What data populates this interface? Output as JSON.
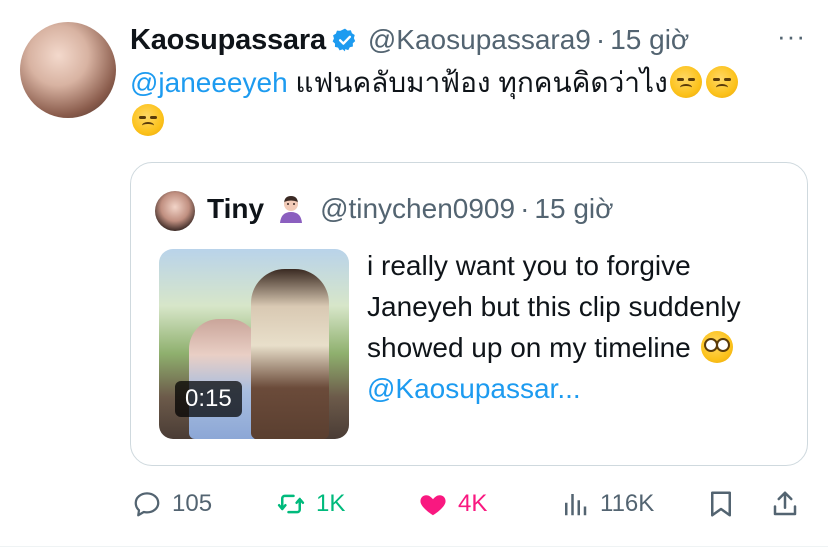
{
  "tweet": {
    "author_name": "Kaosupassara",
    "author_handle": "@Kaosupassara9",
    "separator": "·",
    "time": "15 giờ",
    "more_label": "···",
    "mention": "@janeeeyeh",
    "text": " แฟนคลับมาฟ้อง ทุกคนคิดว่าไง"
  },
  "quoted": {
    "author_name": "Tiny",
    "author_handle": "@tinychen0909",
    "separator": "·",
    "time": "15 giờ",
    "video_duration": "0:15",
    "text": "i really want you to forgive Janeyeh but this clip suddenly showed up on my timeline",
    "mention": "@Kaosupassar..."
  },
  "actions": {
    "replies": "105",
    "retweets": "1K",
    "likes": "4K",
    "views": "116K"
  },
  "colors": {
    "accent": "#1d9bf0",
    "muted": "#536471",
    "retweet": "#00ba7c",
    "like": "#f91880",
    "border": "#cfd9de"
  },
  "icons": [
    "verified-icon",
    "more-icon",
    "reply-icon",
    "retweet-icon",
    "heart-icon",
    "views-icon",
    "bookmark-icon",
    "share-icon"
  ]
}
